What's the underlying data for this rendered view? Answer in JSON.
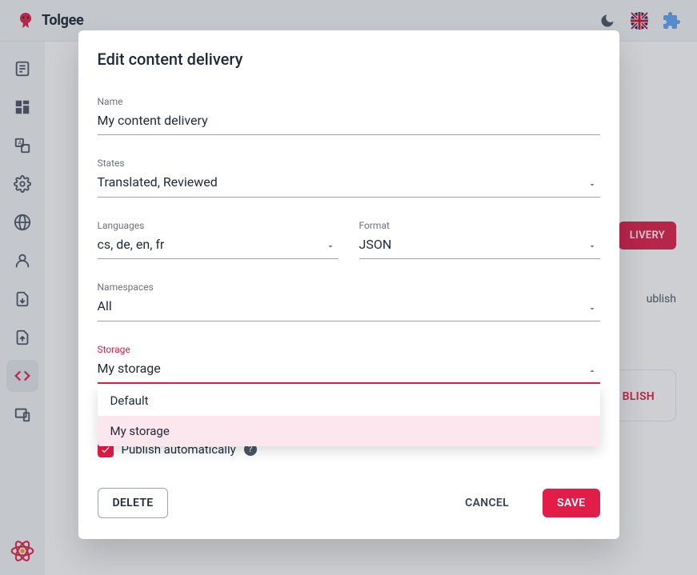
{
  "brand": {
    "name": "Tolgee"
  },
  "background": {
    "pillButton": "LIVERY",
    "textRight": "ublish",
    "cardAction": "BLISH"
  },
  "modal": {
    "title": "Edit content delivery",
    "fields": {
      "name": {
        "label": "Name",
        "value": "My content delivery"
      },
      "states": {
        "label": "States",
        "value": "Translated, Reviewed"
      },
      "languages": {
        "label": "Languages",
        "value": "cs, de, en, fr"
      },
      "format": {
        "label": "Format",
        "value": "JSON"
      },
      "namespaces": {
        "label": "Namespaces",
        "value": "All"
      },
      "storage": {
        "label": "Storage",
        "value": "My storage",
        "options": [
          {
            "label": "Default",
            "selected": false
          },
          {
            "label": "My storage",
            "selected": true
          }
        ]
      }
    },
    "checkbox": {
      "label": "Publish automatically",
      "checked": true
    },
    "buttons": {
      "delete": "DELETE",
      "cancel": "CANCEL",
      "save": "SAVE"
    }
  }
}
